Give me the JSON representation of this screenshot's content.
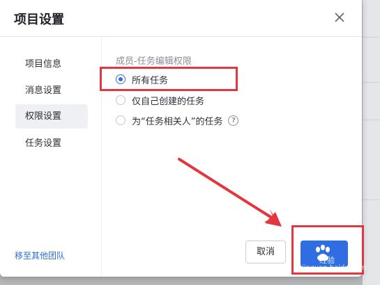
{
  "dialog": {
    "title": "项目设置",
    "close_icon": "close-icon"
  },
  "sidebar": {
    "items": [
      {
        "label": "项目信息"
      },
      {
        "label": "消息设置"
      },
      {
        "label": "权限设置",
        "active": true
      },
      {
        "label": "任务设置"
      }
    ],
    "move_link": "移至其他团队"
  },
  "permissions": {
    "section_title": "成员-任务编辑权限",
    "options": [
      {
        "label": "所有任务",
        "checked": true
      },
      {
        "label": "仅自己创建的任务",
        "checked": false
      },
      {
        "label": "为“任务相关人”的任务",
        "checked": false
      }
    ],
    "help_icon": "?"
  },
  "footer": {
    "cancel_label": "取消"
  },
  "watermark": {
    "text": "经验",
    "url": "jingyan.baidu.com"
  },
  "colors": {
    "accent": "#2f6ee2",
    "annotation": "#e2373f",
    "link": "#2d6cd9"
  }
}
